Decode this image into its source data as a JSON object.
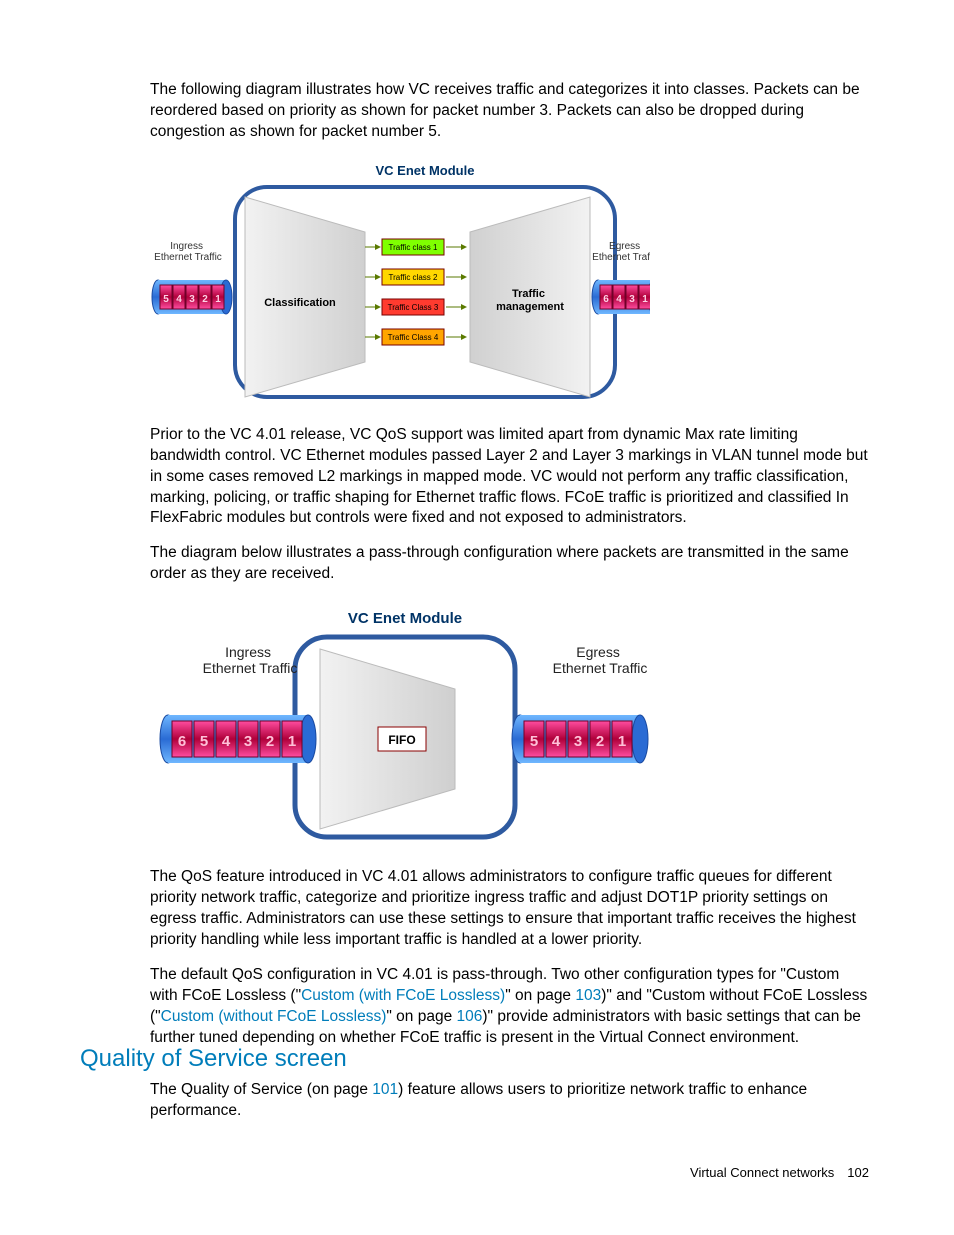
{
  "para1": "The following diagram illustrates how VC receives traffic and categorizes it into classes. Packets can be reordered based on priority as shown for packet number 3. Packets can also be dropped during congestion as shown for packet number 5.",
  "fig1": {
    "title": "VC Enet Module",
    "ingress": "Ingress\nEthernet Traffic",
    "egress": "Egress\nEthernet Traffic",
    "classification": "Classification",
    "trafficMgmt": "Traffic\nmanagement",
    "classes": [
      "Traffic class 1",
      "Traffic class 2",
      "Traffic Class 3",
      "Traffic Class 4"
    ],
    "ingressPkts": [
      "5",
      "4",
      "3",
      "2",
      "1"
    ],
    "egressPkts": [
      "6",
      "4",
      "3",
      "1"
    ]
  },
  "para2": "Prior to the VC 4.01 release, VC QoS support was limited apart from dynamic Max rate limiting bandwidth control. VC Ethernet modules passed Layer 2 and Layer 3 markings in VLAN tunnel mode but in some cases removed L2 markings in mapped mode. VC would not perform any traffic classification, marking, policing, or traffic shaping for Ethernet traffic flows. FCoE traffic is prioritized and classified In FlexFabric modules but controls were fixed and not exposed to administrators.",
  "para3": "The diagram below illustrates a pass-through configuration where packets are transmitted in the same order as they are received.",
  "fig2": {
    "title": "VC Enet Module",
    "ingress": "Ingress\nEthernet Traffic",
    "egress": "Egress\nEthernet Traffic",
    "fifo": "FIFO",
    "ingressPkts": [
      "6",
      "5",
      "4",
      "3",
      "2",
      "1"
    ],
    "egressPkts": [
      "5",
      "4",
      "3",
      "2",
      "1"
    ]
  },
  "para4": "The QoS feature introduced in VC 4.01 allows administrators to configure traffic queues for different priority network traffic, categorize and prioritize ingress traffic and adjust DOT1P priority settings on egress traffic. Administrators can use these settings to ensure that important traffic receives the highest priority handling while less important traffic is handled at a lower priority.",
  "para5a": "The default QoS configuration in VC 4.01 is pass-through. Two other configuration types for \"Custom with FCoE Lossless (\"",
  "link1": "Custom (with FCoE Lossless)",
  "para5b": "\" on page ",
  "pg103": "103",
  "para5c": ")\" and \"Custom without FCoE Lossless (\"",
  "link2": "Custom (without FCoE Lossless)",
  "para5d": "\" on page ",
  "pg106": "106",
  "para5e": ")\" provide administrators with basic settings that can be further tuned depending on whether FCoE traffic is present in the Virtual Connect environment.",
  "heading": "Quality of Service screen",
  "para6a": "The Quality of Service (on page ",
  "pg101": "101",
  "para6b": ") feature allows users to prioritize network traffic to enhance performance.",
  "footer": "Virtual Connect networks 102"
}
